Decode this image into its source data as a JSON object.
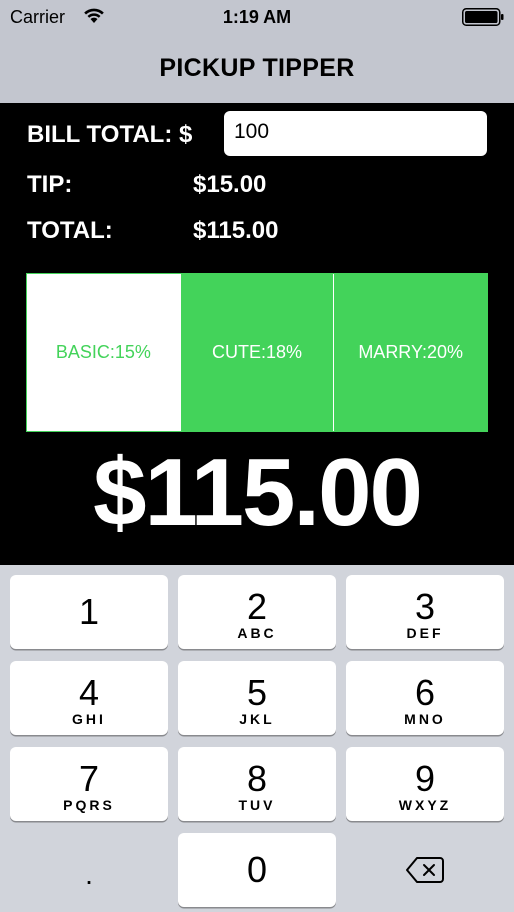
{
  "status_bar": {
    "carrier": "Carrier",
    "time": "1:19 AM",
    "icons": [
      "wifi-icon",
      "battery-icon"
    ]
  },
  "nav": {
    "title": "PICKUP TIPPER"
  },
  "form": {
    "bill_label": "BILL TOTAL: $",
    "bill_value": "100",
    "tip_label": "TIP:",
    "tip_value": "$15.00",
    "total_label": "TOTAL:",
    "total_value": "$115.00"
  },
  "tip_options": {
    "selected": "BASIC:15%",
    "items": [
      "BASIC:15%",
      "CUTE:18%",
      "MARRY:20%"
    ]
  },
  "big_total": "$115.00",
  "keypad": {
    "keys": [
      {
        "digit": "1",
        "letters": ""
      },
      {
        "digit": "2",
        "letters": "ABC"
      },
      {
        "digit": "3",
        "letters": "DEF"
      },
      {
        "digit": "4",
        "letters": "GHI"
      },
      {
        "digit": "5",
        "letters": "JKL"
      },
      {
        "digit": "6",
        "letters": "MNO"
      },
      {
        "digit": "7",
        "letters": "PQRS"
      },
      {
        "digit": "8",
        "letters": "TUV"
      },
      {
        "digit": "9",
        "letters": "WXYZ"
      },
      {
        "digit": ".",
        "letters": ""
      },
      {
        "digit": "0",
        "letters": ""
      }
    ],
    "delete_icon": "delete-backspace-icon"
  },
  "colors": {
    "accent_green": "#43d35a",
    "bar_gray": "#c3c6cf",
    "keypad_bg": "#d1d4db"
  }
}
